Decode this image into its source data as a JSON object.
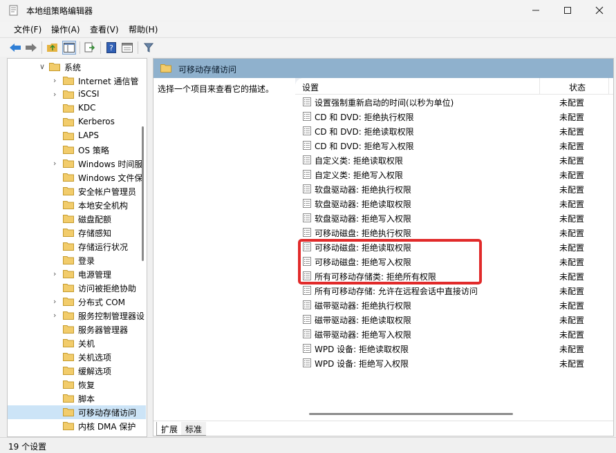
{
  "window": {
    "title": "本地组策略编辑器"
  },
  "menu": [
    {
      "label": "文件(F)"
    },
    {
      "label": "操作(A)"
    },
    {
      "label": "查看(V)"
    },
    {
      "label": "帮助(H)"
    }
  ],
  "toolbar_icons": [
    "back-icon",
    "forward-icon",
    "up-folder-icon",
    "show-hide-tree-icon",
    "export-list-icon",
    "help-icon",
    "properties-icon",
    "filter-icon"
  ],
  "tree": {
    "items": [
      {
        "label": "系统",
        "expanded": true,
        "chevron": "down"
      },
      {
        "label": "Internet 通信管",
        "chevron": "right"
      },
      {
        "label": "iSCSI",
        "chevron": "right"
      },
      {
        "label": "KDC",
        "chevron": ""
      },
      {
        "label": "Kerberos",
        "chevron": ""
      },
      {
        "label": "LAPS",
        "chevron": ""
      },
      {
        "label": "OS 策略",
        "chevron": ""
      },
      {
        "label": "Windows 时间服",
        "chevron": "right"
      },
      {
        "label": "Windows 文件保",
        "chevron": ""
      },
      {
        "label": "安全帐户管理员",
        "chevron": ""
      },
      {
        "label": "本地安全机构",
        "chevron": ""
      },
      {
        "label": "磁盘配额",
        "chevron": ""
      },
      {
        "label": "存储感知",
        "chevron": ""
      },
      {
        "label": "存储运行状况",
        "chevron": ""
      },
      {
        "label": "登录",
        "chevron": ""
      },
      {
        "label": "电源管理",
        "chevron": "right"
      },
      {
        "label": "访问被拒绝协助",
        "chevron": ""
      },
      {
        "label": "分布式 COM",
        "chevron": "right"
      },
      {
        "label": "服务控制管理器设",
        "chevron": "right"
      },
      {
        "label": "服务器管理器",
        "chevron": ""
      },
      {
        "label": "关机",
        "chevron": ""
      },
      {
        "label": "关机选项",
        "chevron": ""
      },
      {
        "label": "缓解选项",
        "chevron": ""
      },
      {
        "label": "恢复",
        "chevron": ""
      },
      {
        "label": "脚本",
        "chevron": ""
      },
      {
        "label": "可移动存储访问",
        "chevron": "",
        "selected": true
      },
      {
        "label": "内核 DMA 保护",
        "chevron": ""
      }
    ]
  },
  "panel": {
    "title": "可移动存储访问",
    "description": "选择一个项目来查看它的描述。",
    "columns": {
      "setting": "设置",
      "state": "状态"
    },
    "rows": [
      {
        "name": "设置强制重新启动的时间(以秒为单位)",
        "state": "未配置"
      },
      {
        "name": "CD 和 DVD: 拒绝执行权限",
        "state": "未配置"
      },
      {
        "name": "CD 和 DVD: 拒绝读取权限",
        "state": "未配置"
      },
      {
        "name": "CD 和 DVD: 拒绝写入权限",
        "state": "未配置"
      },
      {
        "name": "自定义类: 拒绝读取权限",
        "state": "未配置"
      },
      {
        "name": "自定义类: 拒绝写入权限",
        "state": "未配置"
      },
      {
        "name": "软盘驱动器: 拒绝执行权限",
        "state": "未配置"
      },
      {
        "name": "软盘驱动器: 拒绝读取权限",
        "state": "未配置"
      },
      {
        "name": "软盘驱动器: 拒绝写入权限",
        "state": "未配置"
      },
      {
        "name": "可移动磁盘: 拒绝执行权限",
        "state": "未配置"
      },
      {
        "name": "可移动磁盘: 拒绝读取权限",
        "state": "未配置"
      },
      {
        "name": "可移动磁盘: 拒绝写入权限",
        "state": "未配置"
      },
      {
        "name": "所有可移动存储类: 拒绝所有权限",
        "state": "未配置"
      },
      {
        "name": "所有可移动存储: 允许在远程会话中直接访问",
        "state": "未配置"
      },
      {
        "name": "磁带驱动器: 拒绝执行权限",
        "state": "未配置"
      },
      {
        "name": "磁带驱动器: 拒绝读取权限",
        "state": "未配置"
      },
      {
        "name": "磁带驱动器: 拒绝写入权限",
        "state": "未配置"
      },
      {
        "name": "WPD 设备: 拒绝读取权限",
        "state": "未配置"
      },
      {
        "name": "WPD 设备: 拒绝写入权限",
        "state": "未配置"
      }
    ],
    "tabs": [
      {
        "label": "扩展"
      },
      {
        "label": "标准"
      }
    ]
  },
  "status": {
    "text": "19 个设置"
  },
  "colors": {
    "header_bar": "#8fb1cd",
    "selection": "#cce4f7",
    "highlight_box": "#e12a2a"
  }
}
